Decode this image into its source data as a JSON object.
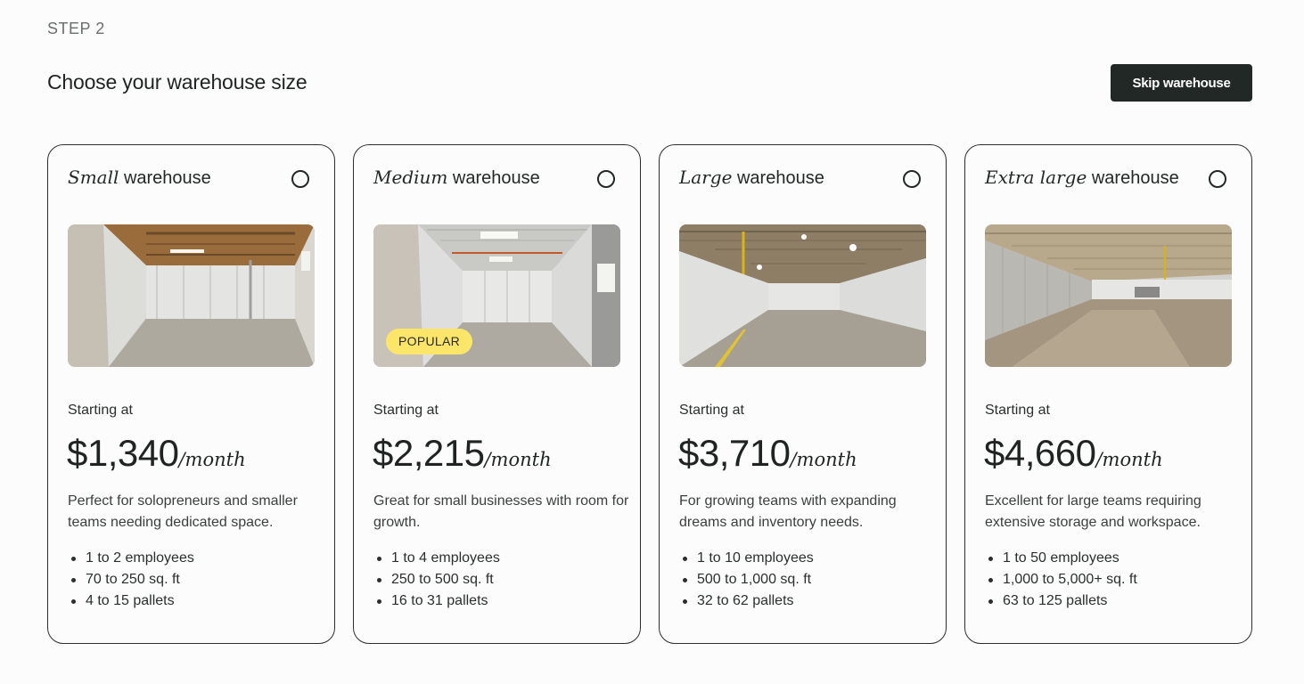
{
  "header": {
    "step": "STEP 2",
    "title": "Choose your warehouse size",
    "skip_label": "Skip warehouse"
  },
  "cards": [
    {
      "size_word": "Small",
      "title_suffix": "warehouse",
      "badge": "",
      "starting_label": "Starting at",
      "price": "$1,340",
      "price_unit": "/month",
      "description": "Perfect for solopreneurs and smaller teams needing dedicated space.",
      "features": [
        "1 to 2 employees",
        "70 to 250 sq. ft",
        "4 to 15 pallets"
      ]
    },
    {
      "size_word": "Medium",
      "title_suffix": "warehouse",
      "badge": "POPULAR",
      "starting_label": "Starting at",
      "price": "$2,215",
      "price_unit": "/month",
      "description": "Great for small businesses with room for growth.",
      "features": [
        "1 to 4 employees",
        "250 to 500 sq. ft",
        "16 to 31 pallets"
      ]
    },
    {
      "size_word": "Large",
      "title_suffix": "warehouse",
      "badge": "",
      "starting_label": "Starting at",
      "price": "$3,710",
      "price_unit": "/month",
      "description": "For growing teams with expanding dreams and inventory needs.",
      "features": [
        "1 to 10 employees",
        "500 to 1,000 sq. ft",
        "32 to 62 pallets"
      ]
    },
    {
      "size_word": "Extra large",
      "title_suffix": "warehouse",
      "badge": "",
      "starting_label": "Starting at",
      "price": "$4,660",
      "price_unit": "/month",
      "description": "Excellent for large teams requiring extensive storage and workspace.",
      "features": [
        "1 to 50 employees",
        "1,000 to 5,000+ sq. ft",
        "63 to 125 pallets"
      ]
    }
  ],
  "colors": {
    "button_bg": "#212826",
    "badge_bg": "#fbe66a",
    "border": "#2a2f2d"
  }
}
